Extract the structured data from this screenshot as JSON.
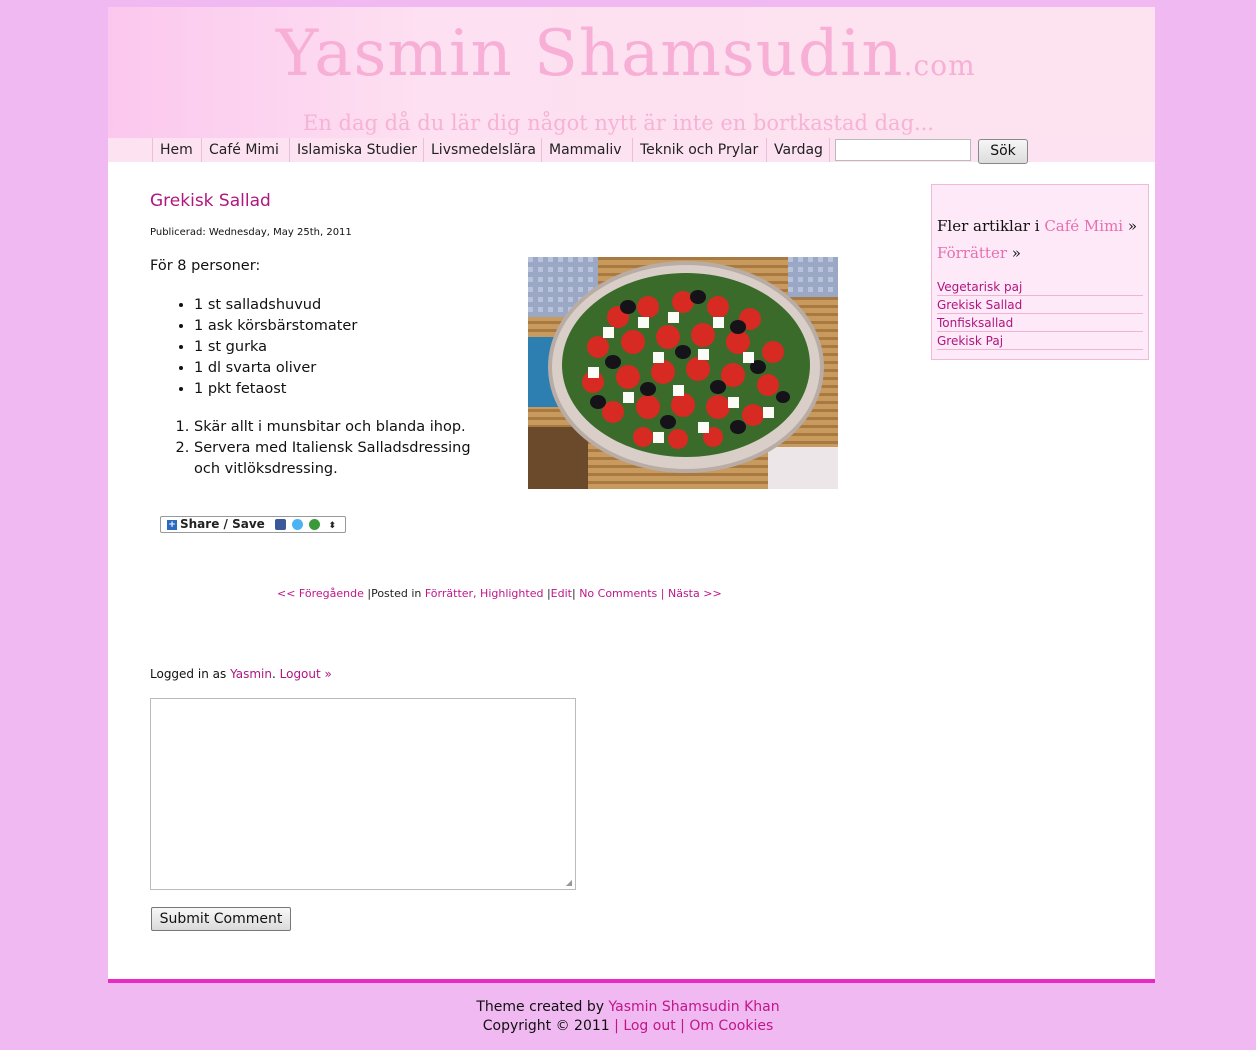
{
  "site": {
    "title": "Yasmin Shamsudin",
    "title_suffix": ".com",
    "tagline": "En dag då du lär dig något nytt är inte en bortkastad dag..."
  },
  "nav": {
    "items": [
      "Hem",
      "Café Mimi",
      "Islamiska Studier",
      "Livsmedelslära",
      "Mammaliv",
      "Teknik och Prylar",
      "Vardag"
    ],
    "search_placeholder": "",
    "search_button": "Sök"
  },
  "post": {
    "title": "Grekisk Sallad",
    "published": "Publicerad: Wednesday, May 25th, 2011",
    "intro": "För 8 personer:",
    "ingredients": [
      "1 st salladshuvud",
      "1 ask körsbärstomater",
      "1 st gurka",
      "1 dl svarta oliver",
      "1 pkt fetaost"
    ],
    "steps": [
      "Skär allt i munsbitar och blanda ihop.",
      "Servera med Italiensk Salladsdressing och vitlöksdressing."
    ],
    "share_label": "Share / Save"
  },
  "post_nav": {
    "prev": "<< Föregående",
    "posted_in": "Posted in",
    "categories": "Förrätter, Highlighted",
    "edit": "Edit",
    "comments": "No Comments",
    "next": "Nästa >>"
  },
  "comments": {
    "logged_in_as": "Logged in as",
    "user": "Yasmin",
    "logout": "Logout »",
    "submit": "Submit Comment"
  },
  "sidebar": {
    "heading_prefix": "Fler artiklar i",
    "category": "Café Mimi",
    "subcategory": "Förrätter",
    "links": [
      "Vegetarisk paj",
      "Grekisk Sallad",
      "Tonfisksallad",
      "Grekisk Paj"
    ]
  },
  "footer": {
    "theme_by": "Theme created by",
    "author": "Yasmin Shamsudin Khan",
    "copyright": "Copyright © 2011",
    "logout": "Log out",
    "cookies": "Om Cookies"
  },
  "colors": {
    "page_bg": "#f0b9f2",
    "accent": "#b0167f",
    "footer_bar": "#ea29c2"
  }
}
